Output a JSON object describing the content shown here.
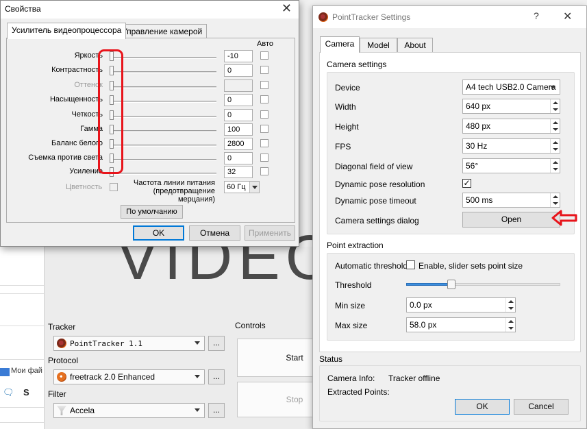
{
  "main_window": {
    "video_text": "VIDEO",
    "tracker_label": "Tracker",
    "tracker_value": "PointTracker 1.1",
    "protocol_label": "Protocol",
    "protocol_value": "freetrack 2.0 Enhanced",
    "filter_label": "Filter",
    "filter_value": "Accela",
    "dots_label": "...",
    "controls_label": "Controls",
    "start_label": "Start",
    "stop_label": "Stop",
    "left_panel_text": "Мои фай",
    "left_icon_s": "S"
  },
  "props_dialog": {
    "title": "Свойства",
    "close": "✕",
    "tabs": [
      "Усилитель видеопроцессора",
      "Управление камерой"
    ],
    "auto_header": "Авто",
    "rows": [
      {
        "label": "Яркость",
        "value": "-10"
      },
      {
        "label": "Контрастность",
        "value": "0"
      },
      {
        "label": "Оттенок",
        "value": ""
      },
      {
        "label": "Насыщенность",
        "value": "0"
      },
      {
        "label": "Четкость",
        "value": "0"
      },
      {
        "label": "Гамма",
        "value": "100"
      },
      {
        "label": "Баланс белого",
        "value": "2800"
      },
      {
        "label": "Съемка против света",
        "value": "0"
      },
      {
        "label": "Усиление",
        "value": "32"
      }
    ],
    "color_label": "Цветность",
    "powerline_label_1": "Частота линии питания",
    "powerline_label_2": "(предотвращение",
    "powerline_label_3": "мерцания)",
    "powerline_value": "60 Гц",
    "default_button": "По умолчанию",
    "ok_button": "OK",
    "cancel_button": "Отмена",
    "apply_button": "Применить"
  },
  "pt_dialog": {
    "title": "PointTracker Settings",
    "help": "?",
    "close": "✕",
    "tabs": [
      "Camera",
      "Model",
      "About"
    ],
    "camera_settings_title": "Camera settings",
    "device_label": "Device",
    "device_value": "A4 tech USB2.0 Camera",
    "width_label": "Width",
    "width_value": "640 px",
    "height_label": "Height",
    "height_value": "480 px",
    "fps_label": "FPS",
    "fps_value": "30 Hz",
    "fov_label": "Diagonal field of view",
    "fov_value": "56°",
    "dyn_res_label": "Dynamic pose resolution",
    "dyn_res_checked": "✓",
    "dyn_timeout_label": "Dynamic pose timeout",
    "dyn_timeout_value": "500 ms",
    "cam_dialog_label": "Camera settings dialog",
    "open_button": "Open",
    "point_extraction_title": "Point extraction",
    "auto_threshold_label": "Automatic threshold",
    "auto_threshold_check_label": "Enable, slider sets point size",
    "threshold_label": "Threshold",
    "threshold_level": 0.28,
    "min_size_label": "Min size",
    "min_size_value": "0.0 px",
    "max_size_label": "Max size",
    "max_size_value": "58.0 px",
    "status_title": "Status",
    "camera_info_label": "Camera Info:",
    "camera_info_value": "Tracker offline",
    "extracted_points_label": "Extracted Points:",
    "ok_button": "OK",
    "cancel_button": "Cancel"
  },
  "colors": {
    "annotation_red": "#e8141b",
    "focus_blue": "#0078d7",
    "slider_blue": "#3c8fde"
  }
}
